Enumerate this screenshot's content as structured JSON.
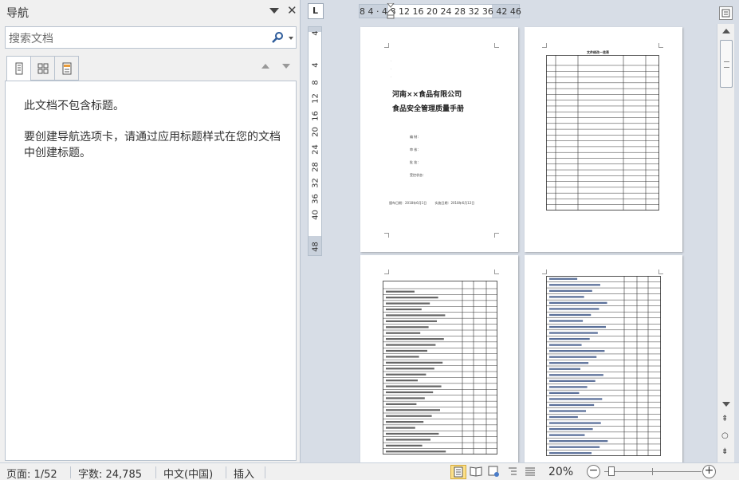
{
  "nav": {
    "title": "导航",
    "search_placeholder": "搜索文档",
    "tabs": [
      "headings-tab",
      "pages-tab",
      "results-tab"
    ],
    "message1": "此文档不包含标题。",
    "message2": "要创建导航选项卡，请通过应用标题样式在您的文档中创建标题。"
  },
  "ruler": {
    "corner": "L",
    "horizontal_labels": "8  4   ·   4  8  12 16 20 24 28 32 36    42 46",
    "vertical_labels": [
      "4",
      "4",
      "8",
      "12",
      "16",
      "20",
      "24",
      "28",
      "32",
      "36",
      "40",
      "48"
    ]
  },
  "pages": {
    "cover": {
      "company": "河南××食品有限公司",
      "title": "食品安全管理质量手册",
      "fields": [
        "编  制：",
        "审  核：",
        "批  准：",
        "受控状态："
      ],
      "dates": "颁布日期：2018年6月1日        实施日期：2018年6月12日"
    },
    "page2_title": "文件修改一览表"
  },
  "status": {
    "page": "页面: 1/52",
    "words": "字数: 24,785",
    "language": "中文(中国)",
    "mode": "插入",
    "zoom": "20%"
  },
  "colors": {
    "accent_active": "#fbe08a",
    "pane_bg": "#f0f0f0",
    "doc_bg": "#d7dde6"
  }
}
